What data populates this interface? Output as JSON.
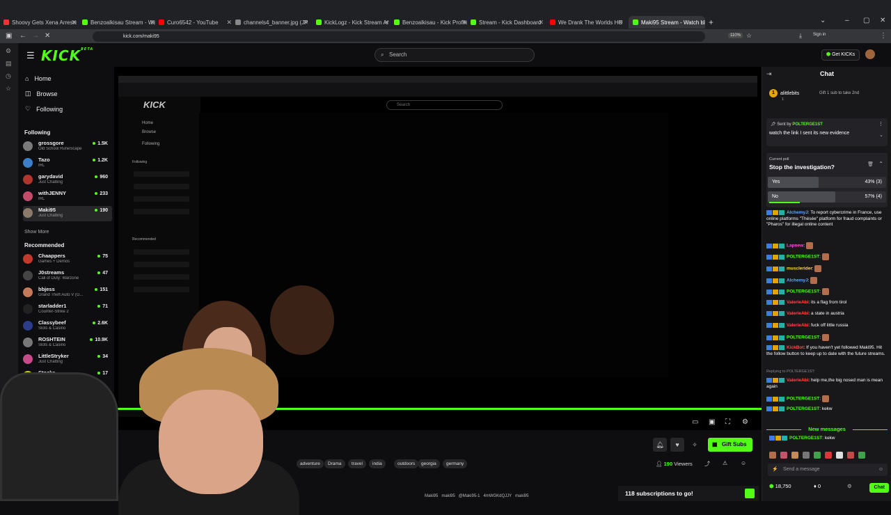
{
  "browser": {
    "tabs": [
      {
        "title": "Shoovy Gets Xena Arrested / Ic",
        "color": "#e33"
      },
      {
        "title": "Benzoalkisau Stream - Watch Li",
        "color": "#53fc18"
      },
      {
        "title": "Curo6542 - YouTube",
        "color": "#f00"
      },
      {
        "title": "channels4_banner.jpg (JPEG Im",
        "color": "#888"
      },
      {
        "title": "KickLogz - Kick Stream Analysis",
        "color": "#53fc18"
      },
      {
        "title": "Benzoalkisau - Kick Profile",
        "color": "#53fc18"
      },
      {
        "title": "Stream - Kick Dashboard",
        "color": "#53fc18"
      },
      {
        "title": "We Drank The Worlds HOTTEST",
        "color": "#f00"
      },
      {
        "title": "Maki95 Stream - Watch Live on",
        "color": "#53fc18"
      }
    ],
    "url": "kick.com/maki95",
    "zoom": "110%",
    "sign_in": "Sign in"
  },
  "kick": {
    "logo": "KICK",
    "logo_sup": "BETA",
    "search_placeholder": "Search",
    "get_kicks": "Get KICKs",
    "nav": {
      "home": "Home",
      "browse": "Browse",
      "following": "Following"
    },
    "following_title": "Following",
    "following": [
      {
        "name": "grossgore",
        "category": "Old School RuneScape",
        "viewers": "1.5K",
        "color": "#7a7a7a"
      },
      {
        "name": "Tazo",
        "category": "IRL",
        "viewers": "1.2K",
        "color": "#3b7fc8"
      },
      {
        "name": "garydavid",
        "category": "Just Chatting",
        "viewers": "960",
        "color": "#b0352c"
      },
      {
        "name": "withJENNY",
        "category": "IRL",
        "viewers": "233",
        "color": "#c44a6a"
      },
      {
        "name": "Maki95",
        "category": "Just Chatting",
        "viewers": "190",
        "color": "#8a7a6a"
      }
    ],
    "show_more": "Show More",
    "recommended_title": "Recommended",
    "recommended": [
      {
        "name": "Chaappers",
        "category": "Games + Demos",
        "viewers": "75",
        "color": "#c0392b"
      },
      {
        "name": "J0streams",
        "category": "Call of Duty: Warzone",
        "viewers": "47",
        "color": "#444"
      },
      {
        "name": "bbjess",
        "category": "Grand Theft Auto V (G...",
        "viewers": "151",
        "color": "#c47a5a"
      },
      {
        "name": "starladder1",
        "category": "Counter-Strike 2",
        "viewers": "71",
        "color": "#222"
      },
      {
        "name": "Classybeef",
        "category": "Slots & Casino",
        "viewers": "2.6K",
        "color": "#2b3c8a"
      },
      {
        "name": "ROSHTEIN",
        "category": "Slots & Casino",
        "viewers": "10.9K",
        "color": "#777"
      },
      {
        "name": "LittleStryker",
        "category": "Just Chatting",
        "viewers": "34",
        "color": "#c44a8a"
      },
      {
        "name": "Stocks",
        "category": "",
        "viewers": "17",
        "color": "#d4d400"
      }
    ],
    "stream": {
      "tags": [
        "adventure",
        "Drama",
        "travel",
        "india",
        "outdoors",
        "georgia",
        "germany"
      ],
      "viewers": "190",
      "viewers_label": "Viewers",
      "gift_subs": "Gift Subs",
      "subscriptions": "118 subscriptions to go!",
      "socials": [
        "Maki95",
        "maki95",
        "@Maki95-1",
        "4mWGKdQJJY",
        "maki95"
      ]
    },
    "inner": {
      "logo": "KICK",
      "search": "Search",
      "home": "Home",
      "browse": "Browse",
      "following": "Following",
      "following_title": "Following",
      "recommended_title": "Recommended"
    }
  },
  "chat": {
    "title": "Chat",
    "gifter": {
      "name": "alittlebits",
      "count": "1",
      "text": "Gift 1 sub to take 2nd",
      "rank": "1"
    },
    "pinned": {
      "sent_by": "Sent by",
      "user": "POLTERGE1ST",
      "message": "watch the link I sent its new evidence"
    },
    "poll": {
      "label": "Current poll",
      "question": "Stop the investigation?",
      "options": [
        {
          "label": "Yes",
          "result": "43% (3)",
          "fraction": 0.43
        },
        {
          "label": "No",
          "result": "57% (4)",
          "fraction": 0.57
        }
      ]
    },
    "messages": [
      {
        "user": "AlchemyJ",
        "color": "#5fa8ff",
        "text": ": To report cybercrime in France, use online platforms \"Thésée\" platform for fraud complaints or \"Pharos\" for illegal online content"
      },
      {
        "user": "Lapnew",
        "color": "#ff4fd8",
        "text": ":"
      },
      {
        "user": "POLTERGE1ST",
        "color": "#53fc18",
        "text": ":"
      },
      {
        "user": "musclerider",
        "color": "#ffd54a",
        "text": ":"
      },
      {
        "user": "AlchemyJ",
        "color": "#5fa8ff",
        "text": ":"
      },
      {
        "user": "POLTERGE1ST",
        "color": "#53fc18",
        "text": ":"
      },
      {
        "user": "ValerieAbi",
        "color": "#ff4a4a",
        "text": ": its a flag from tirol"
      },
      {
        "user": "ValerieAbi",
        "color": "#ff4a4a",
        "text": ": a state in austria"
      },
      {
        "user": "ValerieAbi",
        "color": "#ff4a4a",
        "text": ": fuck off little russia"
      },
      {
        "user": "POLTERGE1ST",
        "color": "#53fc18",
        "text": ":"
      },
      {
        "user": "KickBot",
        "color": "#ff4a4a",
        "text": ": If you haven't yet followed Maki95. Hit the follow button to keep up to date with the future streams."
      },
      {
        "user": "Replying to POLTERGE1ST",
        "color": "#888888",
        "text": ":"
      },
      {
        "user": "ValerieAbi",
        "color": "#ff4a4a",
        "text": ": help me,the big nosed man is mean again"
      },
      {
        "user": "POLTERGE1ST",
        "color": "#53fc18",
        "text": ":"
      },
      {
        "user": "POLTERGE1ST",
        "color": "#53fc18",
        "text": ": kekw"
      }
    ],
    "new_messages": "New messages",
    "last_message": {
      "user": "POLTERGE1ST",
      "text": ": kekw"
    },
    "send_placeholder": "Send a message",
    "kicks_balance": "18,750",
    "zero": "0",
    "chat_button": "Chat"
  }
}
